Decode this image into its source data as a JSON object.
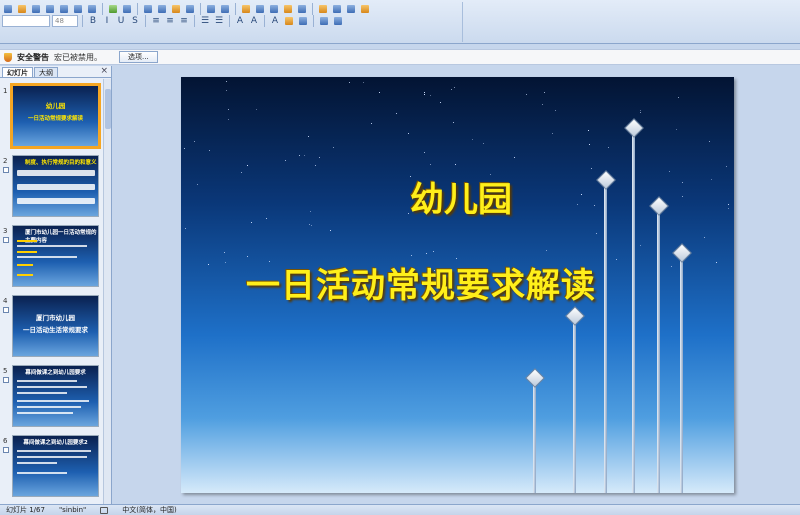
{
  "security_bar": {
    "title": "安全警告",
    "message": "宏已被禁用。",
    "options_button": "选项..."
  },
  "left_pane": {
    "tabs": [
      "幻灯片",
      "大纲"
    ],
    "close": "×",
    "thumbnails": [
      {
        "number": "1",
        "lines": [
          "幼儿园",
          "一日活动常规要求解读"
        ]
      },
      {
        "number": "2",
        "lines": [
          "制度、执行常规的目的和意义"
        ]
      },
      {
        "number": "3",
        "lines": [
          "厦门市幼儿园一日活动常规的主要内容"
        ]
      },
      {
        "number": "4",
        "lines": [
          "厦门市幼儿园",
          "一日活动生活常规要求"
        ]
      },
      {
        "number": "5",
        "lines": [
          "幕间做课之到幼儿园要求"
        ]
      },
      {
        "number": "6",
        "lines": [
          "幕间做课之到幼儿园要求2"
        ]
      }
    ]
  },
  "slide": {
    "title": "幼儿园",
    "subtitle": "一日活动常规要求解读"
  },
  "status_bar": {
    "slide_count": "幻灯片 1/67",
    "theme": "\"sinbin\"",
    "language": "中文(简体，中国)"
  },
  "colors": {
    "title_yellow": "#ffef1a",
    "selection_orange": "#f5a623"
  }
}
